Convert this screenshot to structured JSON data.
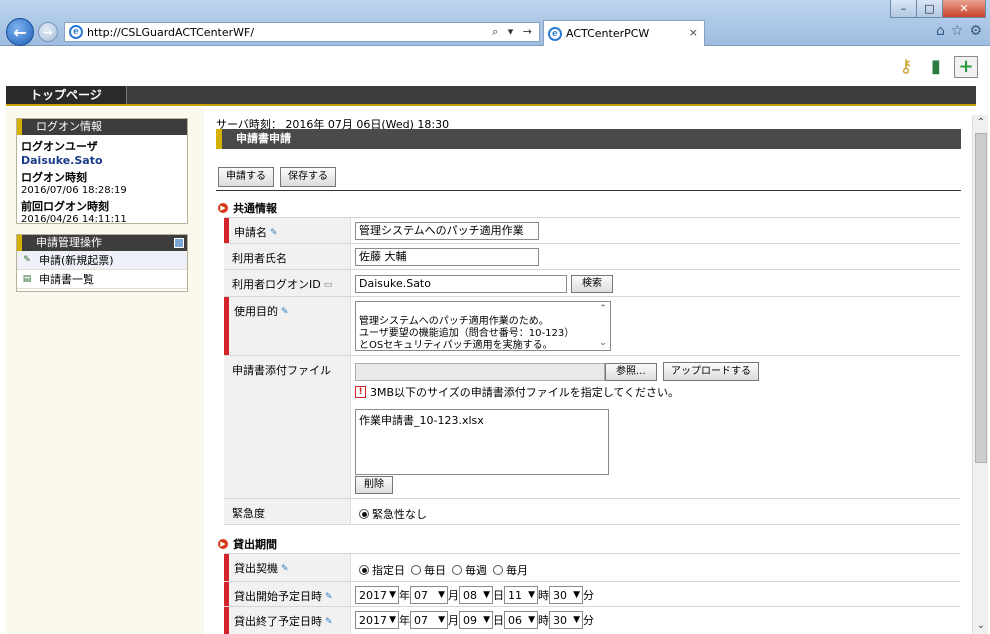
{
  "browser": {
    "url": "http://CSLGuardACTCenterWF/",
    "tab_title": "ACTCenterPCW",
    "tab_close": "×",
    "win_min": "–",
    "win_max": "□",
    "win_close": "✕",
    "back_glyph": "←",
    "fwd_glyph": "→",
    "addr_tools": "⌕ ▾ →",
    "ie_glyph": "e"
  },
  "header": {
    "top_tab": "トップページ"
  },
  "sidebar": {
    "logon_title": "ログオン情報",
    "logon_user_label": "ログオンユーザ",
    "logon_user": "Daisuke.Sato",
    "logon_time_label": "ログオン時刻",
    "logon_time": "2016/07/06 18:28:19",
    "prev_logon_label": "前回ログオン時刻",
    "prev_logon": "2016/04/26 14:11:11",
    "ops_title": "申請管理操作",
    "items": [
      {
        "label": "申請(新規起票)"
      },
      {
        "label": "申請書一覧"
      }
    ]
  },
  "main": {
    "server_time_label": "サーバ時刻：",
    "server_time": "2016年 07月 06日(Wed) 18:30",
    "section_title": "申請書申請",
    "submit_label": "申請する",
    "save_label": "保存する",
    "common_heading": "共通情報",
    "fields": {
      "app_name_label": "申請名",
      "app_name_value": "管理システムへのパッチ適用作業",
      "user_name_label": "利用者氏名",
      "user_name_value": "佐藤 大輔",
      "user_id_label": "利用者ログオンID",
      "user_id_value": "Daisuke.Sato",
      "search_label": "検索",
      "purpose_label": "使用目的",
      "purpose_value": "管理システムへのパッチ適用作業のため。\nユーザ要望の機能追加（問合せ番号：10-123）\nとOSセキュリティパッチ適用を実施する。",
      "attach_label": "申請書添付ファイル",
      "browse_label": "参照...",
      "upload_label": "アップロードする",
      "attach_note": "3MB以下のサイズの申請書添付ファイルを指定してください。",
      "attached_file": "作業申請書_10-123.xlsx",
      "delete_label": "削除",
      "urgency_label": "緊急度",
      "urgency_value": "緊急性なし"
    },
    "loan_heading": "貸出期間",
    "loan": {
      "trigger_label": "貸出契機",
      "trigger_options": [
        "指定日",
        "毎日",
        "毎週",
        "毎月"
      ],
      "start_label": "貸出開始予定日時",
      "end_label": "貸出終了予定日時",
      "start": {
        "year": "2017",
        "month": "07",
        "day": "08",
        "hour": "11",
        "minute": "30"
      },
      "end": {
        "year": "2017",
        "month": "07",
        "day": "09",
        "hour": "06",
        "minute": "30"
      },
      "u_year": "年",
      "u_month": "月",
      "u_day": "日",
      "u_hour": "時",
      "u_minute": "分"
    }
  },
  "colors": {
    "accent_yellow": "#d4b000",
    "required_red": "#d2232a",
    "header_dark": "#3c3c3c"
  }
}
